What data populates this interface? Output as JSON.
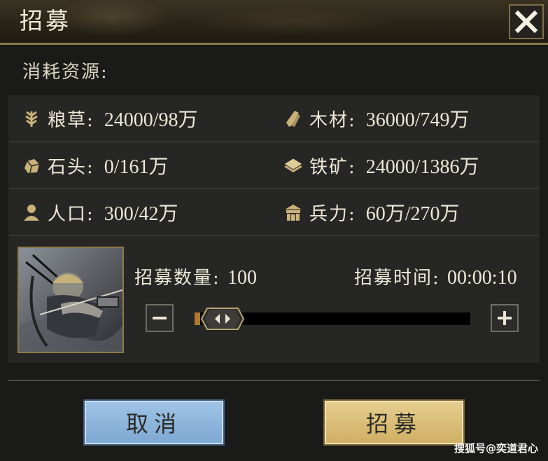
{
  "window": {
    "title": "招募"
  },
  "resources_header": "消耗资源:",
  "resources": [
    {
      "icon": "grain-icon",
      "label": "粮草:",
      "value": "24000/98万"
    },
    {
      "icon": "wood-icon",
      "label": "木材:",
      "value": "36000/749万"
    },
    {
      "icon": "stone-icon",
      "label": "石头:",
      "value": "0/161万"
    },
    {
      "icon": "iron-icon",
      "label": "铁矿:",
      "value": "24000/1386万"
    },
    {
      "icon": "population-icon",
      "label": "人口:",
      "value": "300/42万"
    },
    {
      "icon": "troops-icon",
      "label": "兵力:",
      "value": "60万/270万"
    }
  ],
  "recruit": {
    "qty_label": "招募数量:",
    "qty_value": "100",
    "time_label": "招募时间:",
    "time_value": "00:00:10",
    "slider_fraction": 0.02
  },
  "buttons": {
    "cancel": "取消",
    "confirm": "招募"
  },
  "watermark": "搜狐号@奕道君心",
  "colors": {
    "gold": "#c9b27a",
    "cancel": "#8fb6de",
    "confirm": "#d9bd75"
  }
}
